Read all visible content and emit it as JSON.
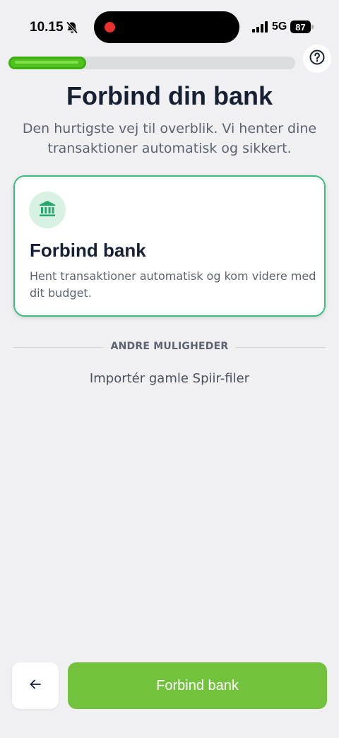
{
  "status_bar": {
    "time": "10.15",
    "network": "5G",
    "battery": "87"
  },
  "progress": {
    "value_percent": 27
  },
  "icons": {
    "bell": "bell-slash-icon",
    "signal": "signal-bars-icon",
    "help": "question-circle-icon",
    "bank": "bank-icon",
    "back": "arrow-left-icon"
  },
  "colors": {
    "accent_green": "#72c23d",
    "progress_green": "#4fc21f",
    "card_border": "#3dbe7f",
    "title": "#152033"
  },
  "header": {
    "title": "Forbind din bank",
    "subtitle": "Den hurtigste vej til overblik. Vi henter dine transaktioner automatisk og sikkert."
  },
  "card": {
    "title": "Forbind bank",
    "description": "Hent transaktioner automatisk og kom videre med dit budget."
  },
  "divider_label": "ANDRE MULIGHEDER",
  "import_link": "Importér gamle Spiir-filer",
  "footer": {
    "primary_label": "Forbind bank"
  }
}
